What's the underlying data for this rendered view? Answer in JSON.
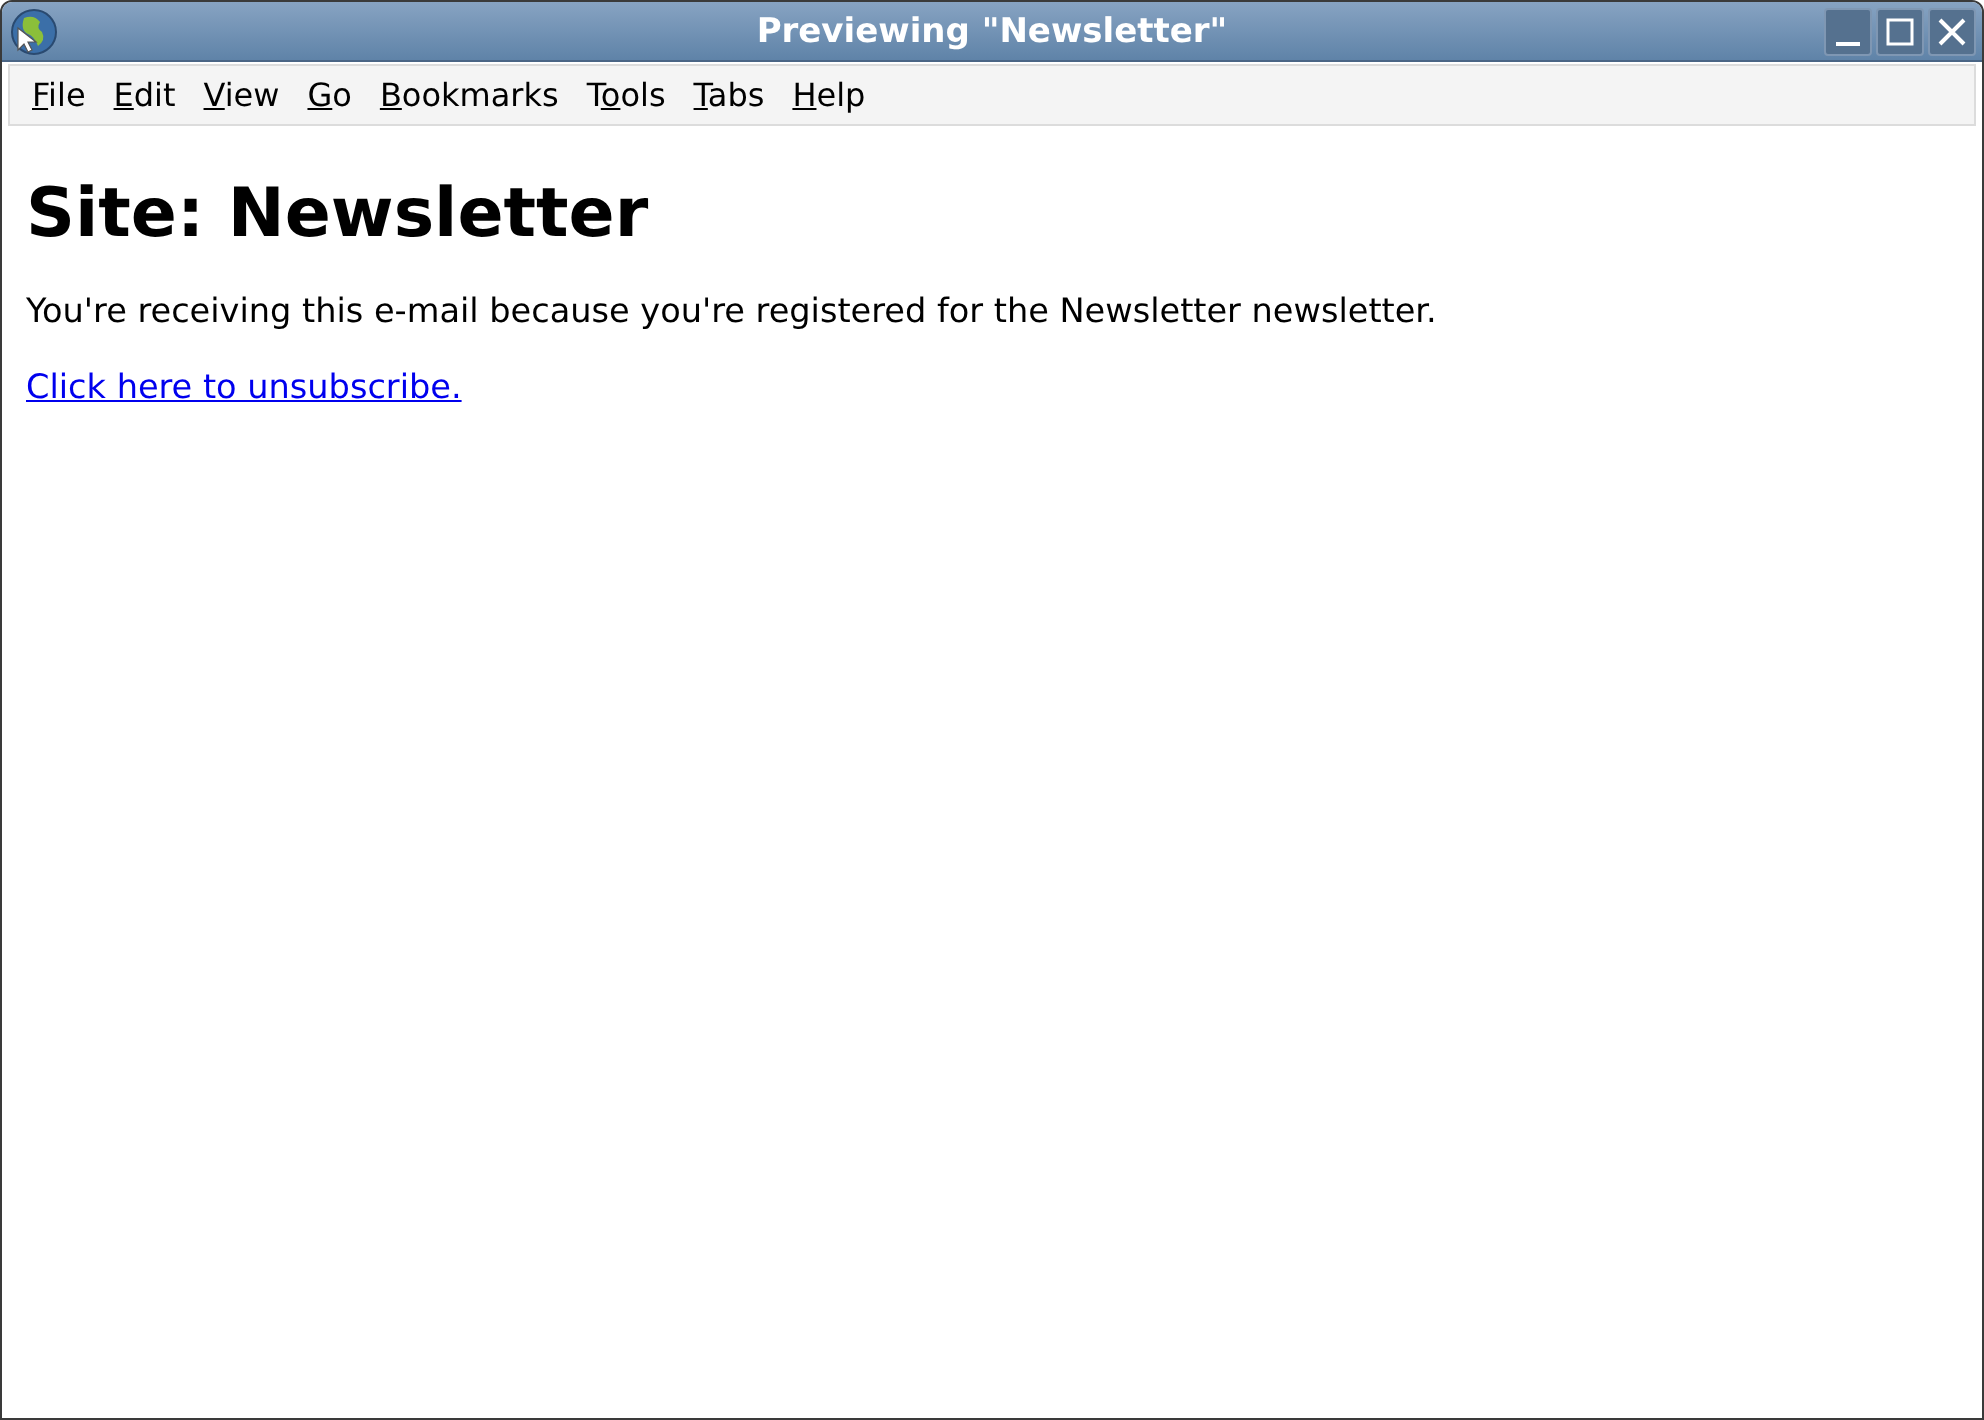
{
  "window": {
    "title": "Previewing \"Newsletter\""
  },
  "menu": [
    {
      "key": "F",
      "after": "ile"
    },
    {
      "key": "E",
      "after": "dit"
    },
    {
      "key": "V",
      "after": "iew"
    },
    {
      "key": "G",
      "after": "o"
    },
    {
      "key": "B",
      "after": "ookmarks"
    },
    {
      "before": "T",
      "key": "o",
      "after": "ols"
    },
    {
      "key": "T",
      "after": "abs"
    },
    {
      "key": "H",
      "after": "elp"
    }
  ],
  "content": {
    "heading": "Site: Newsletter",
    "text": "You're receiving this e-mail because you're registered for the Newsletter newsletter.",
    "link": "Click here to unsubscribe."
  }
}
